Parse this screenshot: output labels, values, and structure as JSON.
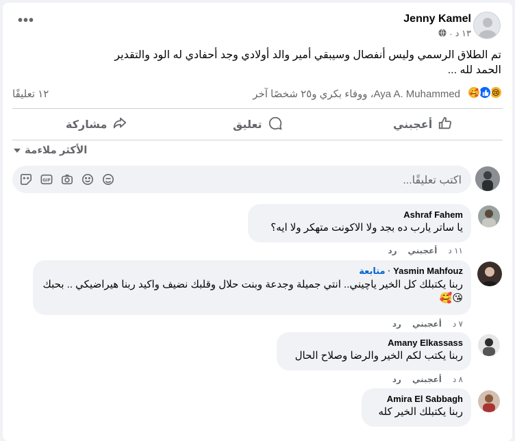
{
  "post": {
    "author": "Jenny Kamel",
    "time": "١٣ د",
    "separator": "·",
    "text": "تم الطلاق الرسمي وليس أنفصال وسيبقي أمير  والد أولادي وجد أحفادي له الود والتقدير الحمد لله ...",
    "more_icon": "more-horizontal-icon",
    "privacy_icon": "globe-icon"
  },
  "reactions": {
    "icons": [
      "sad-icon",
      "like-icon",
      "love-icon"
    ],
    "reactors_text": "Aya A. Muhammed، ووفاء بكري و٢٥ شخصًا آخر",
    "comment_count": "١٢ تعليقًا"
  },
  "actions": {
    "like": "أعجبني",
    "comment": "تعليق",
    "share": "مشاركة"
  },
  "sort": {
    "label": "الأكثر ملاءمة"
  },
  "composer": {
    "placeholder": "اكتب تعليقًا..."
  },
  "comments": [
    {
      "name": "Ashraf Fahem",
      "follow": "",
      "text": "يا ساتر يارب ده بجد ولا الاكونت متهكر ولا ايه؟",
      "time": "١١ د",
      "like": "أعجبني",
      "reply": "رد"
    },
    {
      "name": "Yasmin Mahfouz",
      "follow": "متابعة",
      "text": "ربنا يكتبلك كل الخير ياچيني.. انتي جميلة وجدعة وبنت حلال وقلبك نضيف واكيد ربنا هيراضيكي .. بحبك😘🥰",
      "time": "٧ د",
      "like": "أعجبني",
      "reply": "رد"
    },
    {
      "name": "Amany Elkassass",
      "follow": "",
      "text": "ربنا يكتب لكم الخير والرضا وصلاح الحال",
      "time": "٨ د",
      "like": "أعجبني",
      "reply": "رد"
    },
    {
      "name": "Amira El Sabbagh",
      "follow": "",
      "text": "ربنا يكتبلك الخير كله",
      "time": "",
      "like": "",
      "reply": ""
    }
  ],
  "colors": {
    "accent": "#0866ff",
    "muted": "#65676b",
    "bubble": "#f0f2f5"
  }
}
